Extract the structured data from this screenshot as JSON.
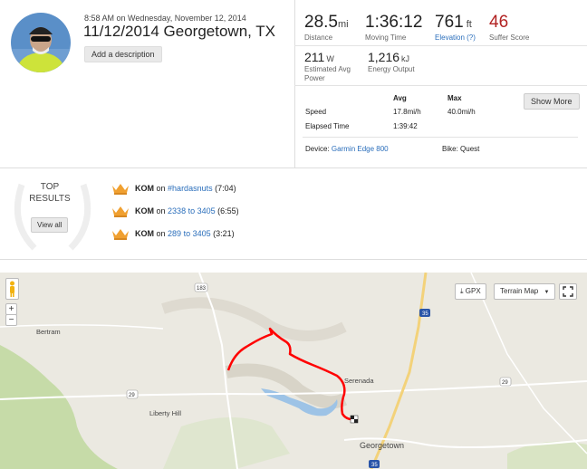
{
  "activity": {
    "timestamp": "8:58 AM on Wednesday, November 12, 2014",
    "title": "11/12/2014 Georgetown, TX",
    "add_description": "Add a description"
  },
  "stats": {
    "distance": {
      "value": "28.5",
      "unit": "mi",
      "label": "Distance"
    },
    "moving_time": {
      "value": "1:36:12",
      "label": "Moving Time"
    },
    "elevation": {
      "value": "761",
      "unit": "ft",
      "label": "Elevation (?)"
    },
    "suffer": {
      "value": "46",
      "label": "Suffer Score"
    },
    "power": {
      "value": "211",
      "unit": "W",
      "label_line1": "Estimated Avg",
      "label_line2": "Power"
    },
    "energy": {
      "value": "1,216",
      "unit": "kJ",
      "label": "Energy Output"
    }
  },
  "detail": {
    "col_avg": "Avg",
    "col_max": "Max",
    "show_more": "Show More",
    "speed_label": "Speed",
    "speed_avg": "17.8mi/h",
    "speed_max": "40.0mi/h",
    "elapsed_label": "Elapsed Time",
    "elapsed_value": "1:39:42",
    "device_label": "Device:",
    "device_value": "Garmin Edge 800",
    "bike_label": "Bike:",
    "bike_value": "Quest"
  },
  "top_results": {
    "title_line1": "TOP",
    "title_line2": "RESULTS",
    "view_all": "View all",
    "items": [
      {
        "badge": "KOM",
        "on": "on",
        "segment": "#hardasnuts",
        "time": "(7:04)"
      },
      {
        "badge": "KOM",
        "on": "on",
        "segment": "2338 to 3405",
        "time": "(6:55)"
      },
      {
        "badge": "KOM",
        "on": "on",
        "segment": "289 to 3405",
        "time": "(3:21)"
      }
    ]
  },
  "map": {
    "gpx": "GPX",
    "map_type": "Terrain Map",
    "zoom_in": "+",
    "zoom_out": "−",
    "places": [
      "Bertram",
      "Serenada",
      "Liberty Hill",
      "Georgetown"
    ],
    "shields": [
      "183",
      "35",
      "29",
      "29",
      "35"
    ],
    "route_color": "#ff0000"
  },
  "colors": {
    "accent_link": "#2a6ebb",
    "suffer": "#b22222",
    "kom_crown": "#f0a030"
  }
}
